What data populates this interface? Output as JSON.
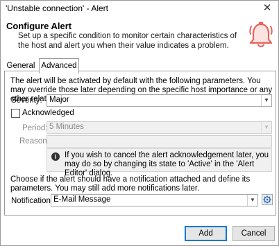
{
  "window": {
    "title": "'Unstable connection' - Alert"
  },
  "header": {
    "title": "Configure Alert",
    "description": "Set up a specific condition to monitor certain characteristics of the host and alert you when their value indicates a problem."
  },
  "tabs": [
    {
      "label": "General",
      "active": false
    },
    {
      "label": "Advanced",
      "active": true
    }
  ],
  "panel": {
    "intro": "The alert will be activated by default with the following parameters. You may override those later depending on the specific host importance or any other related circumstances.",
    "severity": {
      "label": "Severity:",
      "value": "Major"
    },
    "acknowledged": {
      "label": "Acknowledged",
      "checked": false
    },
    "period": {
      "label": "Period:",
      "value": "5 Minutes"
    },
    "reason": {
      "label": "Reason:",
      "value": ""
    },
    "info": "If you wish to cancel the alert acknowledgement later, you may do so by changing its state to 'Active' in the 'Alert Editor' dialog.",
    "notification_intro": "Choose if the alert should have a notification attached and define its parameters. You may still add more notifications later.",
    "notification": {
      "label": "Notification:",
      "value": "E-Mail Message"
    }
  },
  "buttons": {
    "add": "Add",
    "cancel": "Cancel"
  },
  "colors": {
    "bell_accent": "#e8625a",
    "focus_border": "#0078d7"
  },
  "icons": [
    "close-icon",
    "bell-icon",
    "chevron-down-icon",
    "info-icon",
    "gear-icon"
  ]
}
